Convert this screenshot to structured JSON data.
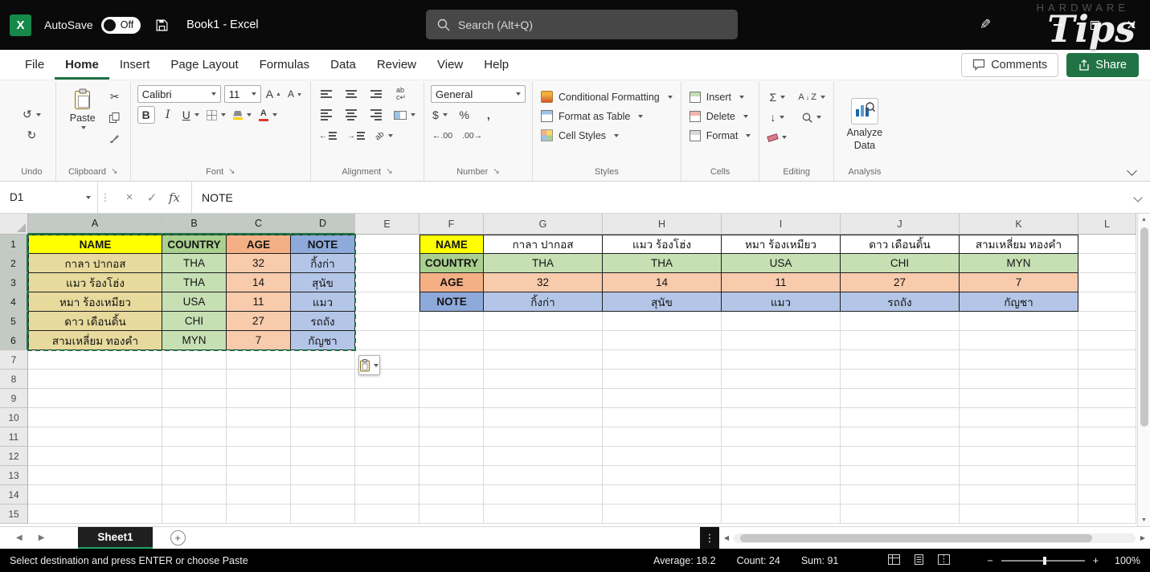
{
  "title_bar": {
    "autosave_label": "AutoSave",
    "autosave_state": "Off",
    "workbook_title": "Book1  -  Excel",
    "search_placeholder": "Search (Alt+Q)",
    "watermark": "Tips",
    "watermark_sub": "HARDWARE"
  },
  "menu": {
    "tabs": [
      "File",
      "Home",
      "Insert",
      "Page Layout",
      "Formulas",
      "Data",
      "Review",
      "View",
      "Help"
    ],
    "active_tab": "Home",
    "comments_label": "Comments",
    "share_label": "Share"
  },
  "ribbon": {
    "groups": [
      "Undo",
      "Clipboard",
      "Font",
      "Alignment",
      "Number",
      "Styles",
      "Cells",
      "Editing",
      "Analysis"
    ],
    "paste_label": "Paste",
    "font_name": "Calibri",
    "font_size": "11",
    "number_format": "General",
    "conditional_formatting_label": "Conditional Formatting",
    "format_as_table_label": "Format as Table",
    "cell_styles_label": "Cell Styles",
    "insert_label": "Insert",
    "delete_label": "Delete",
    "format_label": "Format",
    "analyze_label": "Analyze Data"
  },
  "formula_bar": {
    "name_box": "D1",
    "content": "NOTE"
  },
  "grid": {
    "columns": [
      "A",
      "B",
      "C",
      "D",
      "E",
      "F",
      "G",
      "H",
      "I",
      "J",
      "K",
      "L"
    ],
    "rows": [
      "1",
      "2",
      "3",
      "4",
      "5",
      "6",
      "7",
      "8",
      "9",
      "10",
      "11",
      "12",
      "13",
      "14",
      "15"
    ],
    "selected_columns": [
      "A",
      "B",
      "C",
      "D"
    ],
    "selected_rows": [
      "1",
      "2",
      "3",
      "4",
      "5",
      "6"
    ]
  },
  "left_table": {
    "headers": [
      "NAME",
      "COUNTRY",
      "AGE",
      "NOTE"
    ],
    "rows": [
      [
        "กาลา ปากอส",
        "THA",
        "32",
        "กิ้งก่า"
      ],
      [
        "แมว ร้องโฮ่ง",
        "THA",
        "14",
        "สุนัข"
      ],
      [
        "หมา ร้องเหมียว",
        "USA",
        "11",
        "แมว"
      ],
      [
        "ดาว เดือนดิ้น",
        "CHI",
        "27",
        "รถถัง"
      ],
      [
        "สามเหลี่ยม ทองคำ",
        "MYN",
        "7",
        "กัญชา"
      ]
    ]
  },
  "right_table": {
    "rows": [
      [
        "NAME",
        "กาลา ปากอส",
        "แมว ร้องโฮ่ง",
        "หมา ร้องเหมียว",
        "ดาว เดือนดิ้น",
        "สามเหลี่ยม ทองคำ"
      ],
      [
        "COUNTRY",
        "THA",
        "THA",
        "USA",
        "CHI",
        "MYN"
      ],
      [
        "AGE",
        "32",
        "14",
        "11",
        "27",
        "7"
      ],
      [
        "NOTE",
        "กิ้งก่า",
        "สุนัข",
        "แมว",
        "รถถัง",
        "กัญชา"
      ]
    ]
  },
  "sheet_bar": {
    "tab_label": "Sheet1"
  },
  "status_bar": {
    "message": "Select destination and press ENTER or choose Paste",
    "average": "Average: 18.2",
    "count": "Count: 24",
    "sum": "Sum: 91",
    "zoom": "100%"
  },
  "colors": {
    "accent_green": "#217346",
    "header_fills": [
      "#FFFF00",
      "#A9D08E",
      "#F4B084",
      "#8EAADB"
    ],
    "left_data_fills": [
      "#E7DA9C",
      "#C6E0B4",
      "#F8CBAD",
      "#B4C6E7"
    ],
    "right_data_fills": [
      "#FFFFFF",
      "#C6E0B4",
      "#F8CBAD",
      "#B4C6E7"
    ]
  }
}
